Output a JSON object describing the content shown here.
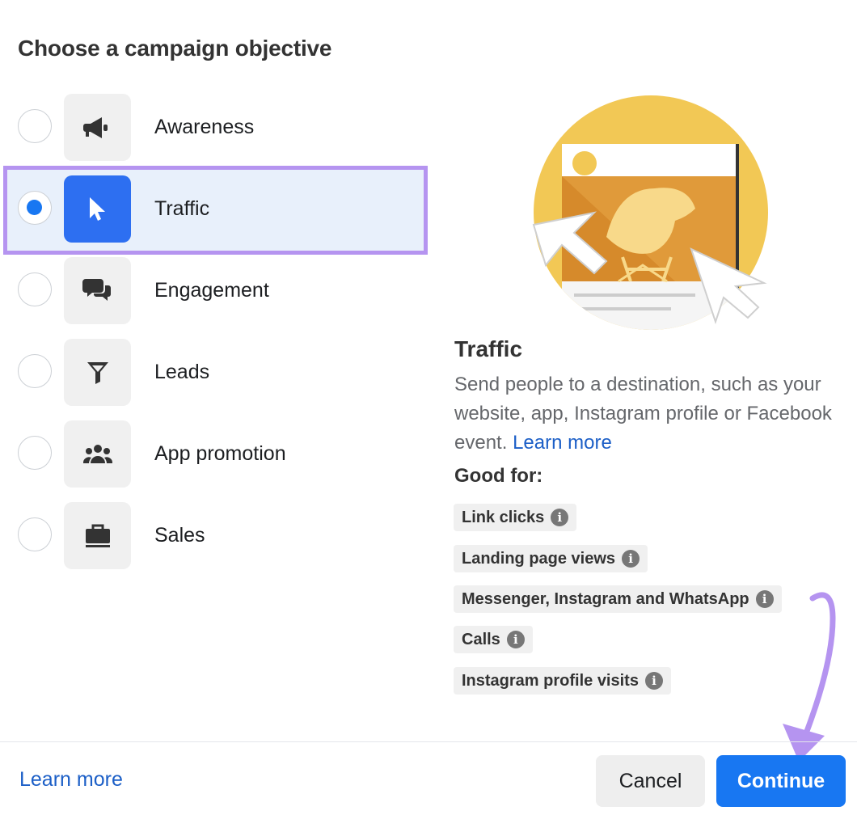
{
  "dialog": {
    "title": "Choose a campaign objective"
  },
  "objectives": [
    {
      "label": "Awareness",
      "icon": "megaphone-icon",
      "selected": false
    },
    {
      "label": "Traffic",
      "icon": "cursor-icon",
      "selected": true
    },
    {
      "label": "Engagement",
      "icon": "chat-bubbles-icon",
      "selected": false
    },
    {
      "label": "Leads",
      "icon": "funnel-icon",
      "selected": false
    },
    {
      "label": "App promotion",
      "icon": "people-icon",
      "selected": false
    },
    {
      "label": "Sales",
      "icon": "briefcase-icon",
      "selected": false
    }
  ],
  "detail": {
    "title": "Traffic",
    "description": "Send people to a destination, such as your website, app, Instagram profile or Facebook event.",
    "learn_more": "Learn more",
    "good_for_label": "Good for:",
    "good_for": [
      "Link clicks",
      "Landing page views",
      "Messenger, Instagram and WhatsApp",
      "Calls",
      "Instagram profile visits"
    ],
    "info_glyph": "i"
  },
  "footer": {
    "learn_more": "Learn more",
    "cancel": "Cancel",
    "continue": "Continue"
  },
  "colors": {
    "accent": "#1877f2",
    "highlight": "#b594f0"
  }
}
